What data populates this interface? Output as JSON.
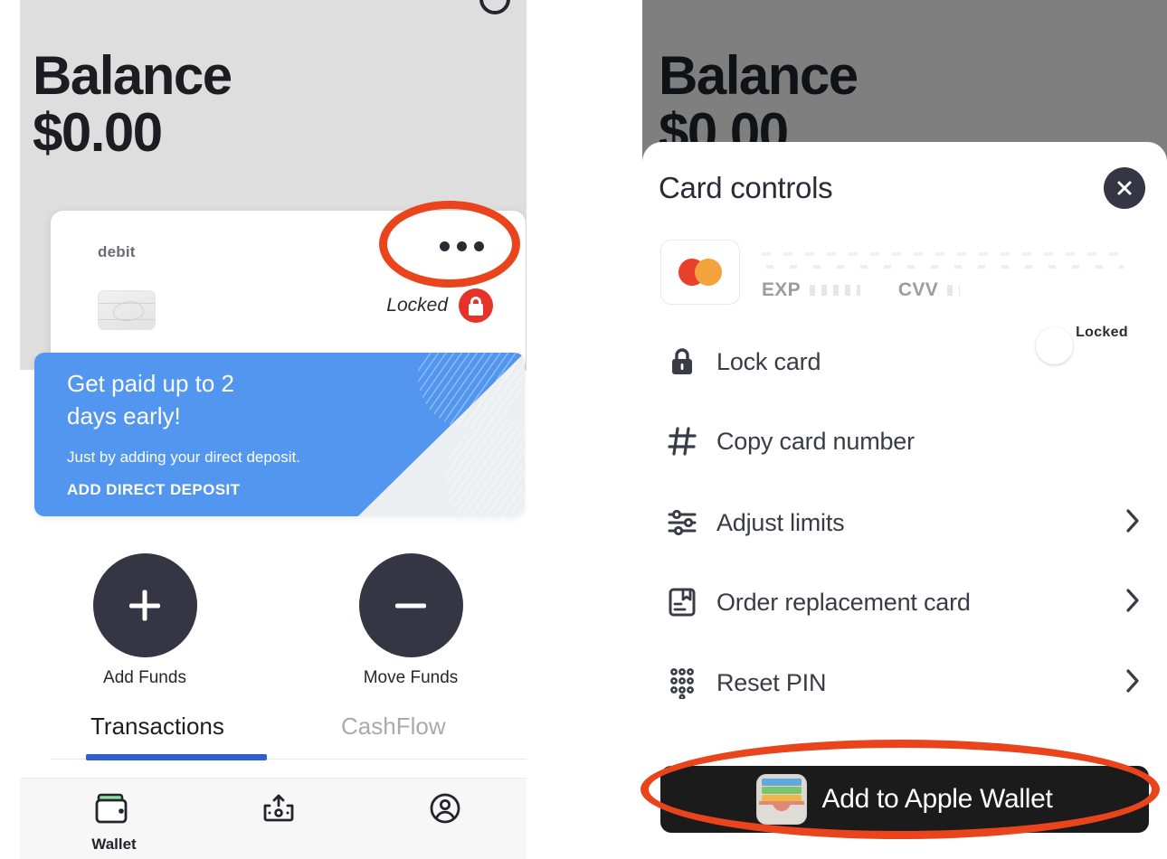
{
  "left_panel": {
    "header": {
      "balance_label": "Balance",
      "balance_value": "$0.00",
      "top_icon": "info-circle-icon",
      "background_color": "#dddedd"
    },
    "card_tile": {
      "brand_label": "debit",
      "more_menu_icon": "ellipsis-icon",
      "status_text": "Locked",
      "status_icon": "lock-badge-icon",
      "status_color": "#e63329",
      "card_art_icon": "card-logo-placeholder-icon"
    },
    "promo": {
      "title": "Get paid up to 2\ndays early!",
      "subtitle": "Just by adding your direct deposit.",
      "cta_label": "ADD DIRECT DEPOSIT",
      "background_color": "#5396ef"
    },
    "actions": [
      {
        "label": "Add Funds",
        "icon": "plus-icon"
      },
      {
        "label": "Move Funds",
        "icon": "minus-icon"
      }
    ],
    "tabs": [
      {
        "label": "Transactions",
        "active": true
      },
      {
        "label": "CashFlow",
        "active": false
      }
    ],
    "tab_underline_color": "#2f5fc9",
    "bottom_nav": [
      {
        "label": "Wallet",
        "icon": "wallet-icon",
        "active": true
      },
      {
        "label": "",
        "icon": "deposit-check-icon",
        "active": false
      },
      {
        "label": "",
        "icon": "account-circle-icon",
        "active": false
      }
    ]
  },
  "right_panel": {
    "backdrop": {
      "balance_label": "Balance",
      "balance_value": "$0.00",
      "dim_color": "#807f7f"
    },
    "sheet": {
      "title": "Card controls",
      "close_icon": "close-icon",
      "card_summary": {
        "network_icon": "mastercard-icon",
        "card_number_masked": "",
        "exp_label": "EXP",
        "exp_value_masked": "",
        "cvv_label": "CVV",
        "cvv_value_masked": ""
      },
      "rows": [
        {
          "label": "Lock card",
          "icon": "lock-icon",
          "control": "toggle",
          "toggle_on": true,
          "toggle_label": "Locked",
          "toggle_color": "#4a90e8"
        },
        {
          "label": "Copy card number",
          "icon": "hash-icon",
          "control": "none"
        },
        {
          "label": "Adjust limits",
          "icon": "sliders-icon",
          "control": "chevron"
        },
        {
          "label": "Order replacement card",
          "icon": "card-save-icon",
          "control": "chevron"
        },
        {
          "label": "Reset PIN",
          "icon": "keypad-dots-icon",
          "control": "chevron"
        }
      ],
      "wallet_button": {
        "label": "Add to Apple Wallet",
        "icon": "apple-wallet-icon",
        "background_color": "#1b1b1b"
      }
    }
  },
  "annotations": {
    "color": "#ea441c",
    "items": [
      {
        "target": "ellipsis-icon",
        "shape": "ellipse"
      },
      {
        "target": "apple-wallet-button",
        "shape": "ellipse"
      }
    ]
  }
}
